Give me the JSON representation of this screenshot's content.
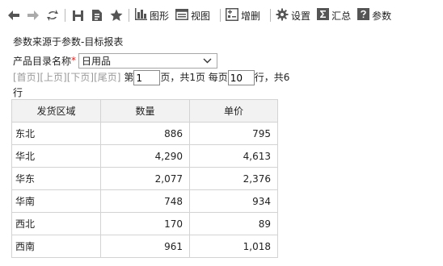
{
  "toolbar": {
    "chart_label": "图形",
    "view_label": "视图",
    "edit_label": "增删",
    "settings_label": "设置",
    "summary_label": "汇总",
    "params_label": "参数"
  },
  "report": {
    "title": "参数来源于参数-目标报表"
  },
  "param": {
    "label": "产品目录名称",
    "required_mark": "*",
    "value": "日用品"
  },
  "pager": {
    "first": "[首页]",
    "prev": "[上页]",
    "next": "[下页]",
    "last": "[尾页]",
    "page_prefix": "第",
    "current_page": "1",
    "page_suffix": "页，共1页 每页",
    "page_size": "10",
    "total_text": "行，共6行"
  },
  "table": {
    "headers": [
      "发货区域",
      "数量",
      "单价"
    ],
    "rows": [
      {
        "region": "东北",
        "qty": "886",
        "price": "795"
      },
      {
        "region": "华北",
        "qty": "4,290",
        "price": "4,613"
      },
      {
        "region": "华东",
        "qty": "2,077",
        "price": "2,376"
      },
      {
        "region": "华南",
        "qty": "748",
        "price": "934"
      },
      {
        "region": "西北",
        "qty": "170",
        "price": "89"
      },
      {
        "region": "西南",
        "qty": "961",
        "price": "1,018"
      }
    ]
  },
  "colors": {
    "icon": "#555555",
    "header_bg": "#f2f2f2",
    "grid_border": "#d3d3d3",
    "link_gray": "#999999",
    "required_red": "#e02020"
  }
}
